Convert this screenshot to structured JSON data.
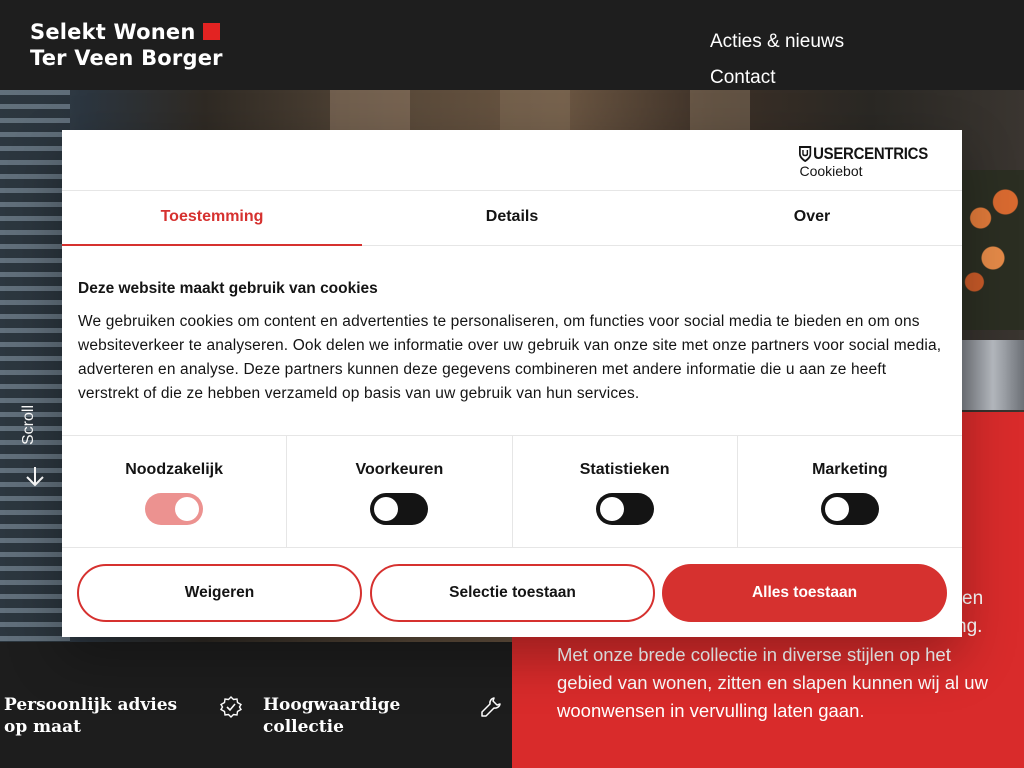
{
  "header": {
    "logo_line1": "Selekt Wonen",
    "logo_line2": "Ter Veen Borger",
    "nav": [
      "Acties & nieuws",
      "Contact"
    ]
  },
  "hero": {
    "scroll_label": "Scroll"
  },
  "red_block": {
    "fragment1": "en",
    "fragment2": "ng.",
    "paragraph": "Met onze brede collectie in diverse stijlen op het gebied van wonen, zitten en slapen kunnen wij al uw woonwensen in vervulling laten gaan."
  },
  "features": [
    {
      "label": "Persoonlijk advies op maat"
    },
    {
      "label": "Hoogwaardige collectie"
    }
  ],
  "cookie_dialog": {
    "brand_name": "USERCENTRICS",
    "brand_sub": "Cookiebot",
    "tabs": [
      "Toestemming",
      "Details",
      "Over"
    ],
    "active_tab": "Toestemming",
    "title": "Deze website maakt gebruik van cookies",
    "text": "We gebruiken cookies om content en advertenties te personaliseren, om functies voor social media te bieden en om ons websiteverkeer te analyseren. Ook delen we informatie over uw gebruik van onze site met onze partners voor social media, adverteren en analyse. Deze partners kunnen deze gegevens combineren met andere informatie die u aan ze heeft verstrekt of die ze hebben verzameld op basis van uw gebruik van hun services.",
    "toggles": [
      {
        "label": "Noodzakelijk",
        "checked": true
      },
      {
        "label": "Voorkeuren",
        "checked": false
      },
      {
        "label": "Statistieken",
        "checked": false
      },
      {
        "label": "Marketing",
        "checked": false
      }
    ],
    "buttons": {
      "reject": "Weigeren",
      "selection": "Selectie toestaan",
      "accept_all": "Alles toestaan"
    }
  },
  "colors": {
    "accent_red": "#d6312f",
    "logo_red": "#e32322",
    "dark": "#1d1d1d"
  }
}
